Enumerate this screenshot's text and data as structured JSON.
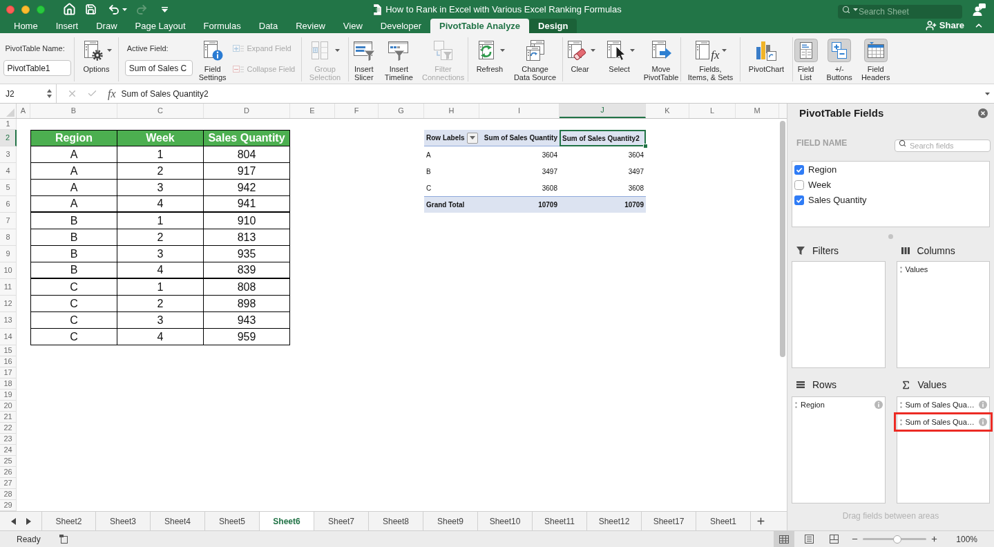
{
  "window": {
    "title": "How to Rank in Excel with Various Excel Ranking Formulas",
    "search": {
      "placeholder": "Search Sheet"
    }
  },
  "quick_access": {
    "redo_disabled": true
  },
  "ribbon_tabs": [
    {
      "label": "Home",
      "selected": false,
      "contextual": false
    },
    {
      "label": "Insert",
      "selected": false,
      "contextual": false
    },
    {
      "label": "Draw",
      "selected": false,
      "contextual": false
    },
    {
      "label": "Page Layout",
      "selected": false,
      "contextual": false
    },
    {
      "label": "Formulas",
      "selected": false,
      "contextual": false
    },
    {
      "label": "Data",
      "selected": false,
      "contextual": false
    },
    {
      "label": "Review",
      "selected": false,
      "contextual": false
    },
    {
      "label": "View",
      "selected": false,
      "contextual": false
    },
    {
      "label": "Developer",
      "selected": false,
      "contextual": false
    },
    {
      "label": "PivotTable Analyze",
      "selected": true,
      "contextual": true
    },
    {
      "label": "Design",
      "selected": false,
      "contextual": true
    }
  ],
  "share": {
    "label": "Share"
  },
  "ribbon": {
    "groups": [
      {
        "items": [
          {
            "kind": "field",
            "label": "PivotTable Name:",
            "value": "PivotTable1"
          }
        ]
      },
      {
        "items": [
          {
            "kind": "large",
            "lines": [
              "Options"
            ],
            "dropdown": true,
            "disabled": false,
            "pressed": false
          }
        ]
      },
      {
        "items": [
          {
            "kind": "field",
            "label": "Active Field:",
            "value": "Sum of Sales C"
          },
          {
            "kind": "large",
            "lines": [
              "Field",
              "Settings"
            ],
            "dropdown": false,
            "disabled": false,
            "pressed": false
          },
          {
            "kind": "stack",
            "buttons": [
              {
                "label": "Expand Field",
                "disabled": true
              },
              {
                "label": "Collapse Field",
                "disabled": true
              }
            ]
          }
        ]
      },
      {
        "items": [
          {
            "kind": "large",
            "lines": [
              "Group",
              "Selection"
            ],
            "dropdown": true,
            "disabled": true,
            "pressed": false
          }
        ]
      },
      {
        "items": [
          {
            "kind": "large",
            "lines": [
              "Insert",
              "Slicer"
            ],
            "dropdown": false,
            "disabled": false,
            "pressed": false
          },
          {
            "kind": "large",
            "lines": [
              "Insert",
              "Timeline"
            ],
            "dropdown": false,
            "disabled": false,
            "pressed": false
          },
          {
            "kind": "large",
            "lines": [
              "Filter",
              "Connections"
            ],
            "dropdown": false,
            "disabled": true,
            "pressed": false
          }
        ]
      },
      {
        "items": [
          {
            "kind": "large",
            "lines": [
              "Refresh"
            ],
            "dropdown": true,
            "disabled": false,
            "pressed": false
          },
          {
            "kind": "large",
            "lines": [
              "Change",
              "Data Source"
            ],
            "dropdown": false,
            "disabled": false,
            "pressed": false
          }
        ]
      },
      {
        "items": [
          {
            "kind": "large",
            "lines": [
              "Clear"
            ],
            "dropdown": true,
            "disabled": false,
            "pressed": false
          },
          {
            "kind": "large",
            "lines": [
              "Select"
            ],
            "dropdown": true,
            "disabled": false,
            "pressed": false
          },
          {
            "kind": "large",
            "lines": [
              "Move",
              "PivotTable"
            ],
            "dropdown": false,
            "disabled": false,
            "pressed": false
          }
        ]
      },
      {
        "items": [
          {
            "kind": "large",
            "lines": [
              "Fields,",
              "Items, & Sets"
            ],
            "glyph": "fx",
            "dropdown": true,
            "disabled": false,
            "pressed": false
          }
        ]
      },
      {
        "items": [
          {
            "kind": "large",
            "lines": [
              "PivotChart"
            ],
            "dropdown": false,
            "disabled": false,
            "pressed": false
          }
        ]
      },
      {
        "items": [
          {
            "kind": "large",
            "lines": [
              "Field",
              "List"
            ],
            "dropdown": false,
            "disabled": false,
            "pressed": true
          },
          {
            "kind": "large",
            "lines": [
              "+/-",
              "Buttons"
            ],
            "dropdown": false,
            "disabled": false,
            "pressed": true
          },
          {
            "kind": "large",
            "lines": [
              "Field",
              "Headers"
            ],
            "dropdown": false,
            "disabled": false,
            "pressed": true
          }
        ]
      }
    ]
  },
  "formula_bar": {
    "cell_ref": "J2",
    "function_label": "fx",
    "formula": "Sum of Sales Quantity2"
  },
  "sheet": {
    "columns": [
      {
        "label": "A",
        "selected": false
      },
      {
        "label": "B",
        "selected": false
      },
      {
        "label": "C",
        "selected": false
      },
      {
        "label": "D",
        "selected": false
      },
      {
        "label": "E",
        "selected": false
      },
      {
        "label": "F",
        "selected": false
      },
      {
        "label": "G",
        "selected": false
      },
      {
        "label": "H",
        "selected": false
      },
      {
        "label": "I",
        "selected": false
      },
      {
        "label": "J",
        "selected": true
      },
      {
        "label": "K",
        "selected": false
      },
      {
        "label": "L",
        "selected": false
      },
      {
        "label": "M",
        "selected": false
      }
    ],
    "rows": [
      {
        "label": "1",
        "selected": false
      },
      {
        "label": "2",
        "selected": true
      },
      {
        "label": "3",
        "selected": false
      },
      {
        "label": "4",
        "selected": false
      },
      {
        "label": "5",
        "selected": false
      },
      {
        "label": "6",
        "selected": false
      },
      {
        "label": "7",
        "selected": false
      },
      {
        "label": "8",
        "selected": false
      },
      {
        "label": "9",
        "selected": false
      },
      {
        "label": "10",
        "selected": false
      },
      {
        "label": "11",
        "selected": false
      },
      {
        "label": "12",
        "selected": false
      },
      {
        "label": "13",
        "selected": false
      },
      {
        "label": "14",
        "selected": false
      },
      {
        "label": "15",
        "selected": false
      },
      {
        "label": "16",
        "selected": false
      },
      {
        "label": "17",
        "selected": false
      },
      {
        "label": "18",
        "selected": false
      },
      {
        "label": "19",
        "selected": false
      },
      {
        "label": "20",
        "selected": false
      },
      {
        "label": "21",
        "selected": false
      },
      {
        "label": "22",
        "selected": false
      },
      {
        "label": "23",
        "selected": false
      },
      {
        "label": "24",
        "selected": false
      },
      {
        "label": "25",
        "selected": false
      },
      {
        "label": "26",
        "selected": false
      },
      {
        "label": "27",
        "selected": false
      },
      {
        "label": "28",
        "selected": false
      },
      {
        "label": "29",
        "selected": false
      }
    ]
  },
  "data_table": {
    "columns": [
      "Region",
      "Week",
      "Sales Quantity"
    ],
    "rows": [
      [
        "A",
        "1",
        "804"
      ],
      [
        "A",
        "2",
        "917"
      ],
      [
        "A",
        "3",
        "942"
      ],
      [
        "A",
        "4",
        "941"
      ],
      [
        "B",
        "1",
        "910"
      ],
      [
        "B",
        "2",
        "813"
      ],
      [
        "B",
        "3",
        "935"
      ],
      [
        "B",
        "4",
        "839"
      ],
      [
        "C",
        "1",
        "808"
      ],
      [
        "C",
        "2",
        "898"
      ],
      [
        "C",
        "3",
        "943"
      ],
      [
        "C",
        "4",
        "959"
      ]
    ]
  },
  "pivot_table": {
    "row_labels": "Row Labels",
    "columns": [
      {
        "label": "Sum of Sales Quantity",
        "selected": false
      },
      {
        "label": "Sum of Sales Quantity2",
        "selected": true
      }
    ],
    "rows": [
      {
        "label": "A",
        "values": [
          "3604",
          "3604"
        ]
      },
      {
        "label": "B",
        "values": [
          "3497",
          "3497"
        ]
      },
      {
        "label": "C",
        "values": [
          "3608",
          "3608"
        ]
      }
    ],
    "total": {
      "label": "Grand Total",
      "values": [
        "10709",
        "10709"
      ]
    }
  },
  "field_panel": {
    "title": "PivotTable Fields",
    "field_name_heading": "FIELD NAME",
    "search": {
      "placeholder": "Search fields"
    },
    "fields": [
      {
        "label": "Region",
        "checked": true
      },
      {
        "label": "Week",
        "checked": false
      },
      {
        "label": "Sales Quantity",
        "checked": true
      }
    ],
    "areas": [
      {
        "title": "Filters"
      },
      {
        "title": "Columns",
        "items": [
          {
            "label": "Values",
            "info": false,
            "highlighted": false
          }
        ]
      },
      {
        "title": "Rows",
        "items": [
          {
            "label": "Region",
            "info": true,
            "highlighted": false
          }
        ]
      },
      {
        "title": "Values",
        "items": [
          {
            "label": "Sum of Sales Qua…",
            "info": true,
            "highlighted": false
          },
          {
            "label": "Sum of Sales Qua…",
            "info": true,
            "highlighted": true
          }
        ]
      }
    ],
    "hint": "Drag fields between areas"
  },
  "sheet_tabs": [
    {
      "label": "Sheet2",
      "selected": false
    },
    {
      "label": "Sheet3",
      "selected": false
    },
    {
      "label": "Sheet4",
      "selected": false
    },
    {
      "label": "Sheet5",
      "selected": false
    },
    {
      "label": "Sheet6",
      "selected": true
    },
    {
      "label": "Sheet7",
      "selected": false
    },
    {
      "label": "Sheet8",
      "selected": false
    },
    {
      "label": "Sheet9",
      "selected": false
    },
    {
      "label": "Sheet10",
      "selected": false
    },
    {
      "label": "Sheet11",
      "selected": false
    },
    {
      "label": "Sheet12",
      "selected": false
    },
    {
      "label": "Sheet17",
      "selected": false
    },
    {
      "label": "Sheet1",
      "selected": false
    }
  ],
  "status_bar": {
    "status": "Ready",
    "views": [
      {
        "selected": true
      },
      {
        "selected": false
      },
      {
        "selected": false
      }
    ],
    "zoom": {
      "level": 0.55,
      "reading": "100%"
    }
  }
}
